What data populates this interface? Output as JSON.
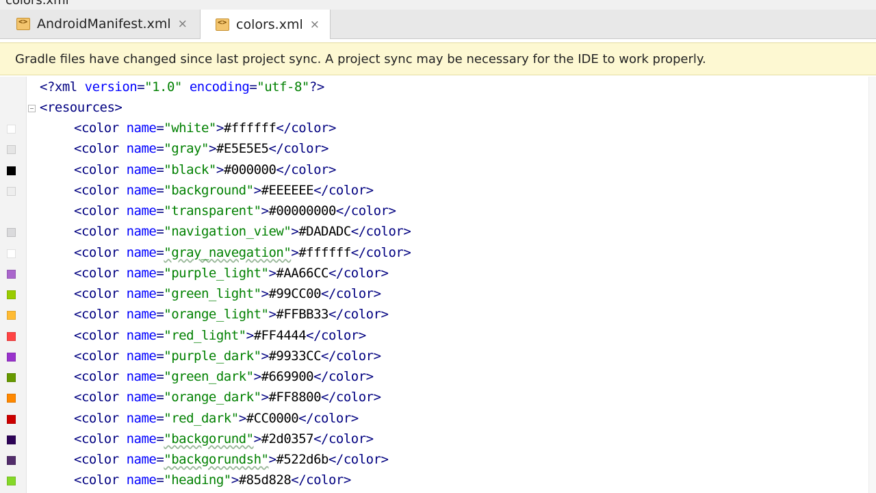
{
  "window": {
    "title": "colors.xml"
  },
  "tabs": [
    {
      "label": "AndroidManifest.xml",
      "icon": "xml-file-icon",
      "close": "×",
      "active": false
    },
    {
      "label": "colors.xml",
      "icon": "xml-file-icon",
      "close": "×",
      "active": true
    }
  ],
  "notification": {
    "message": "Gradle files have changed since last project sync. A project sync may be necessary for the IDE to work properly."
  },
  "editor": {
    "declaration": {
      "open": "<?xml ",
      "a1": "version",
      "eq1": "=",
      "v1": "\"1.0\"",
      "a2": "encoding",
      "eq2": "=",
      "v2": "\"utf-8\"",
      "close": "?>"
    },
    "root_open": "<resources>",
    "tag_open": "<color ",
    "attr_name": "name",
    "eq": "=",
    "tag_mid": ">",
    "tag_close": "</color>",
    "colors": [
      {
        "name": "\"white\"",
        "value": "#ffffff",
        "swatch": "#ffffff"
      },
      {
        "name": "\"gray\"",
        "value": "#E5E5E5",
        "swatch": "#e5e5e5"
      },
      {
        "name": "\"black\"",
        "value": "#000000",
        "swatch": "#000000"
      },
      {
        "name": "\"background\"",
        "value": "#EEEEEE",
        "swatch": "#eeeeee"
      },
      {
        "name": "\"transparent\"",
        "value": "#00000000",
        "swatch": ""
      },
      {
        "name": "\"navigation_view\"",
        "value": "#DADADC",
        "swatch": "#dadadc"
      },
      {
        "name": "\"gray_navegation\"",
        "value": "#ffffff",
        "swatch": "#ffffff"
      },
      {
        "name": "\"purple_light\"",
        "value": "#AA66CC",
        "swatch": "#aa66cc"
      },
      {
        "name": "\"green_light\"",
        "value": "#99CC00",
        "swatch": "#99cc00"
      },
      {
        "name": "\"orange_light\"",
        "value": "#FFBB33",
        "swatch": "#ffbb33"
      },
      {
        "name": "\"red_light\"",
        "value": "#FF4444",
        "swatch": "#ff4444"
      },
      {
        "name": "\"purple_dark\"",
        "value": "#9933CC",
        "swatch": "#9933cc"
      },
      {
        "name": "\"green_dark\"",
        "value": "#669900",
        "swatch": "#669900"
      },
      {
        "name": "\"orange_dark\"",
        "value": "#FF8800",
        "swatch": "#ff8800"
      },
      {
        "name": "\"red_dark\"",
        "value": "#CC0000",
        "swatch": "#cc0000"
      },
      {
        "name": "\"backgorund\"",
        "value": "#2d0357",
        "swatch": "#2d0357"
      },
      {
        "name": "\"backgorundsh\"",
        "value": "#522d6b",
        "swatch": "#522d6b"
      },
      {
        "name": "\"heading\"",
        "value": "#85d828",
        "swatch": "#85d828"
      }
    ],
    "squiggly_names": [
      "\"gray_navegation\"",
      "\"backgorund\"",
      "\"backgorundsh\""
    ]
  }
}
